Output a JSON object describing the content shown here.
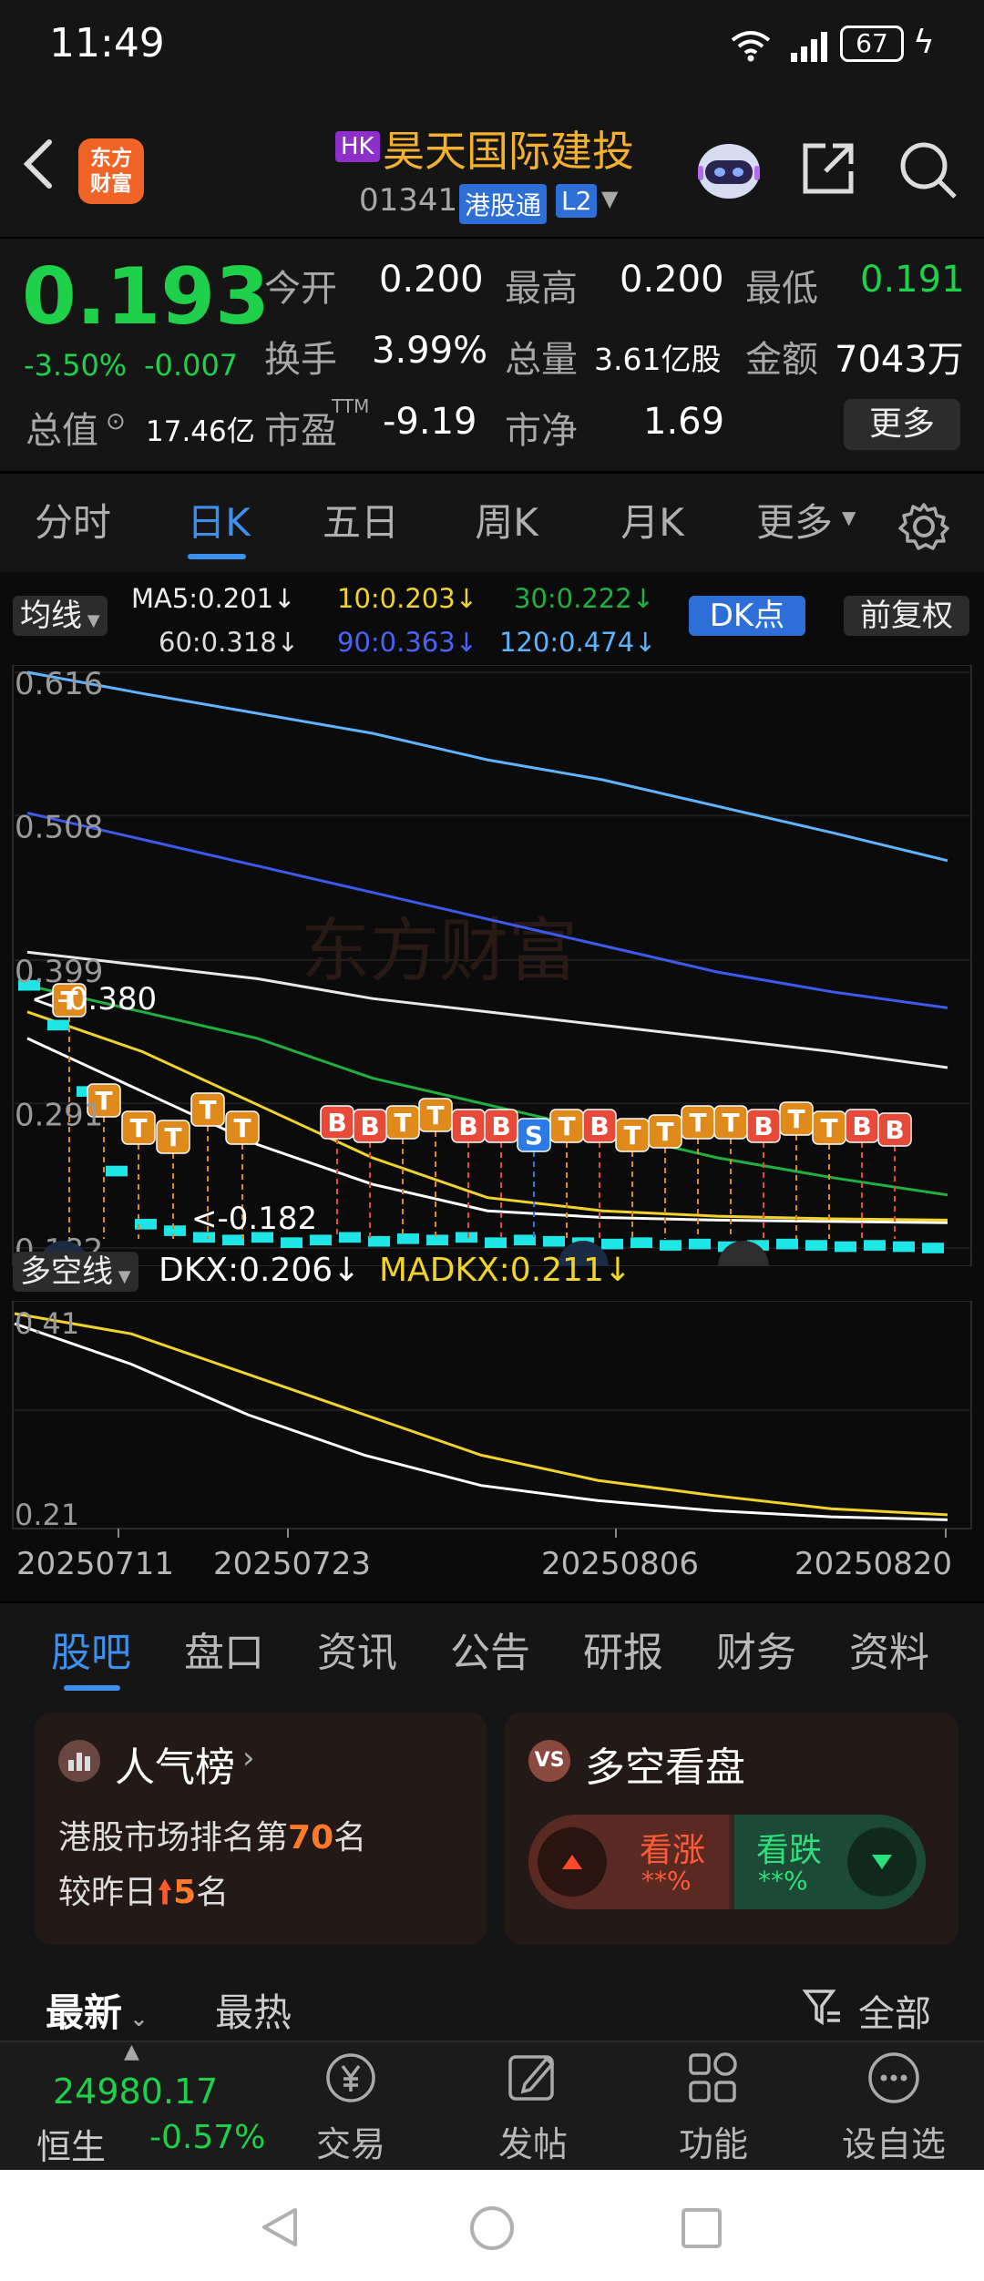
{
  "status": {
    "time": "11:49",
    "battery": "67"
  },
  "header": {
    "logo_text": "东方\n财富",
    "hk_badge": "HK",
    "stock_name": "昊天国际建投",
    "code": "01341",
    "connect_badge": "港股通",
    "level_badge": "L2"
  },
  "quote": {
    "price": "0.193",
    "change_pct": "-3.50%",
    "change": "-0.007",
    "open_label": "今开",
    "open": "0.200",
    "high_label": "最高",
    "high": "0.200",
    "low_label": "最低",
    "low": "0.191",
    "turnover_label": "换手",
    "turnover": "3.99%",
    "volume_label": "总量",
    "volume": "3.61亿股",
    "amount_label": "金额",
    "amount": "7043万",
    "mcap_label": "总值",
    "mcap": "17.46亿",
    "pe_label": "市盈",
    "pe_sup": "TTM",
    "pe": "-9.19",
    "pb_label": "市净",
    "pb": "1.69",
    "more_label": "更多"
  },
  "tabs": [
    "分时",
    "日K",
    "五日",
    "周K",
    "月K",
    "更多"
  ],
  "ma_legend": {
    "selector": "均线",
    "ma5": "MA5:0.201↓",
    "ma10": "10:0.203↓",
    "ma30": "30:0.222↓",
    "ma60": "60:0.318↓",
    "ma90": "90:0.363↓",
    "ma120": "120:0.474↓",
    "dk_button": "DK点",
    "adjust_button": "前复权"
  },
  "chart_data": [
    {
      "type": "line",
      "y_ticks": [
        "0.616",
        "0.508",
        "0.399",
        "0.291",
        "0.182"
      ],
      "ylim": [
        0.182,
        0.616
      ],
      "annotations": [
        "0.380",
        "0.182"
      ],
      "watermark": "东方财富",
      "series": [
        {
          "name": "MA5",
          "color": "#ffffff",
          "values": [
            0.34,
            0.3,
            0.26,
            0.23,
            0.21,
            0.205,
            0.203,
            0.202,
            0.201
          ]
        },
        {
          "name": "10",
          "color": "#f2d32c",
          "values": [
            0.36,
            0.33,
            0.29,
            0.25,
            0.22,
            0.21,
            0.206,
            0.204,
            0.203
          ]
        },
        {
          "name": "30",
          "color": "#20b040",
          "values": [
            0.38,
            0.36,
            0.34,
            0.31,
            0.29,
            0.27,
            0.25,
            0.235,
            0.222
          ]
        },
        {
          "name": "60",
          "color": "#e8e8e8",
          "values": [
            0.405,
            0.395,
            0.385,
            0.37,
            0.36,
            0.35,
            0.34,
            0.33,
            0.318
          ]
        },
        {
          "name": "90",
          "color": "#3d5af0",
          "values": [
            0.51,
            0.49,
            0.47,
            0.45,
            0.43,
            0.41,
            0.39,
            0.375,
            0.363
          ]
        },
        {
          "name": "120",
          "color": "#5fb4ff",
          "values": [
            0.616,
            0.6,
            0.585,
            0.57,
            0.55,
            0.535,
            0.515,
            0.495,
            0.474
          ]
        }
      ],
      "markers": [
        "T",
        "T",
        "T",
        "T",
        "T",
        "T",
        "B",
        "B",
        "T",
        "T",
        "B",
        "B",
        "S",
        "T",
        "B",
        "T",
        "T",
        "T",
        "T",
        "B",
        "T",
        "T",
        "B",
        "B"
      ]
    },
    {
      "type": "line",
      "selector": "多空线",
      "dkx_label": "DKX:0.206↓",
      "madkx_label": "MADKX:0.211↓",
      "y_ticks": [
        "0.41",
        "0.21"
      ],
      "ylim": [
        0.21,
        0.41
      ],
      "series": [
        {
          "name": "DKX",
          "color": "#ffffff",
          "values": [
            0.4,
            0.36,
            0.31,
            0.27,
            0.24,
            0.225,
            0.215,
            0.209,
            0.206
          ]
        },
        {
          "name": "MADKX",
          "color": "#f2d32c",
          "values": [
            0.41,
            0.39,
            0.35,
            0.31,
            0.27,
            0.245,
            0.23,
            0.217,
            0.211
          ]
        }
      ],
      "x_ticks": [
        "20250711",
        "20250723",
        "20250806",
        "20250820"
      ]
    }
  ],
  "bottom_tabs": [
    "股吧",
    "盘口",
    "资讯",
    "公告",
    "研报",
    "财务",
    "资料"
  ],
  "cards": {
    "popularity": {
      "title": "人气榜",
      "line1_prefix": "港股市场排名第",
      "rank": "70",
      "line1_suffix": "名",
      "line2_prefix": "较昨日",
      "change": "5",
      "line2_suffix": "名"
    },
    "sentiment": {
      "title": "多空看盘",
      "bull_label": "看涨",
      "bull_value": "**%",
      "bear_label": "看跌",
      "bear_value": "**%"
    }
  },
  "feed": {
    "latest": "最新",
    "hot": "最热",
    "filter": "全部"
  },
  "bottom_nav": {
    "index_value": "24980.17",
    "index_name": "恒生",
    "index_change": "-0.57%",
    "trade": "交易",
    "post": "发帖",
    "function": "功能",
    "watchlist": "设自选"
  }
}
